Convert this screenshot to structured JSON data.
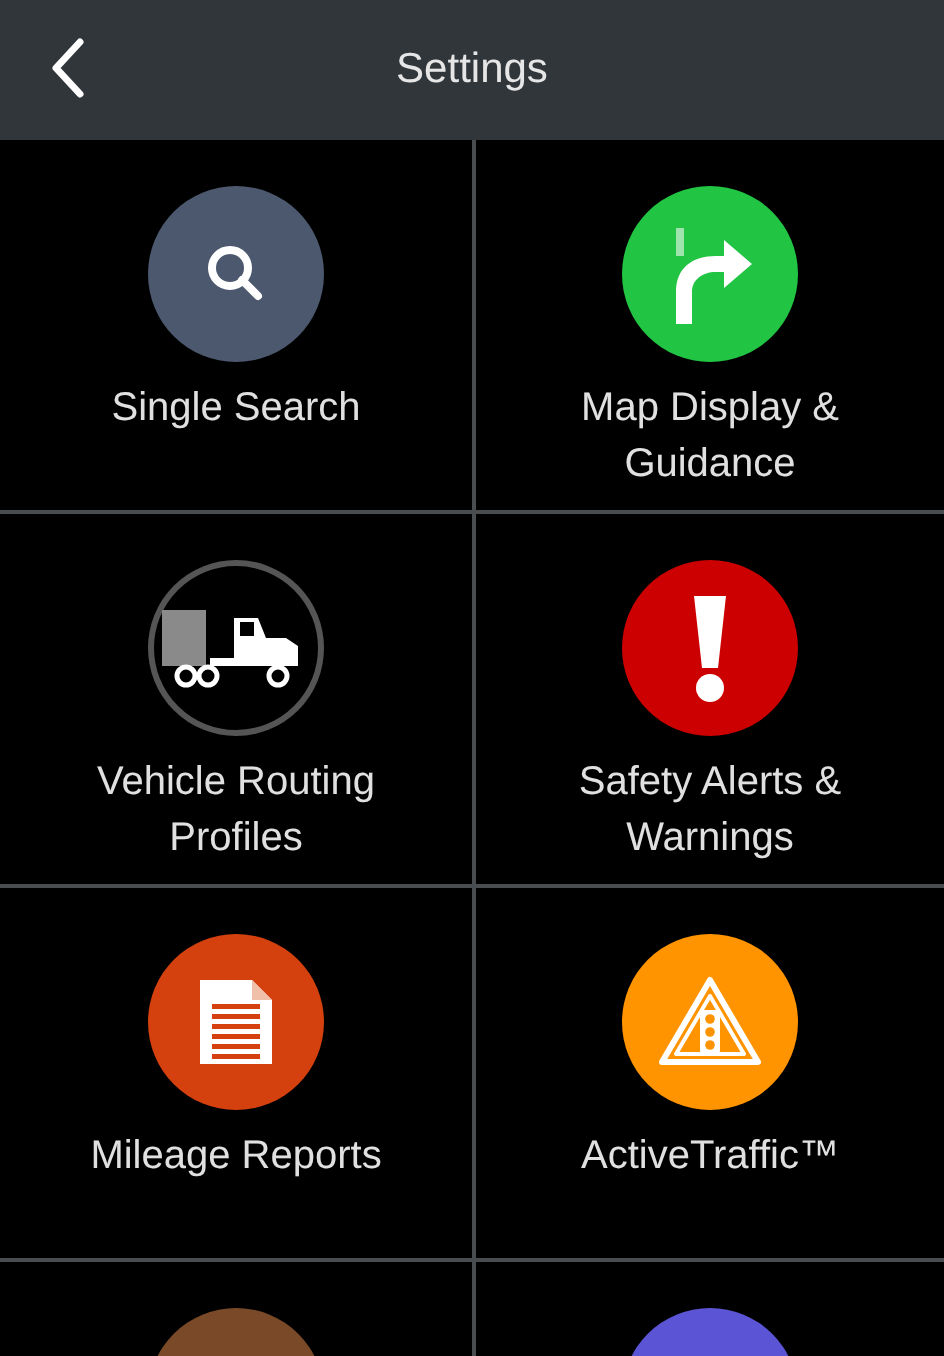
{
  "header": {
    "title": "Settings"
  },
  "tiles": [
    {
      "label": "Single Search",
      "kind": "search",
      "color": "#4b586e"
    },
    {
      "label": "Map Display & Guidance",
      "kind": "turn",
      "color": "#22c443"
    },
    {
      "label": "Vehicle Routing Profiles",
      "kind": "truck",
      "color": "#000000"
    },
    {
      "label": "Safety Alerts & Warnings",
      "kind": "alert",
      "color": "#cc0000"
    },
    {
      "label": "Mileage Reports",
      "kind": "document",
      "color": "#d4400e"
    },
    {
      "label": "ActiveTraffic™",
      "kind": "traffic",
      "color": "#ff9400"
    },
    {
      "kind": "blank",
      "color": "#7a4a28"
    },
    {
      "kind": "blank",
      "color": "#5b54d4"
    }
  ]
}
